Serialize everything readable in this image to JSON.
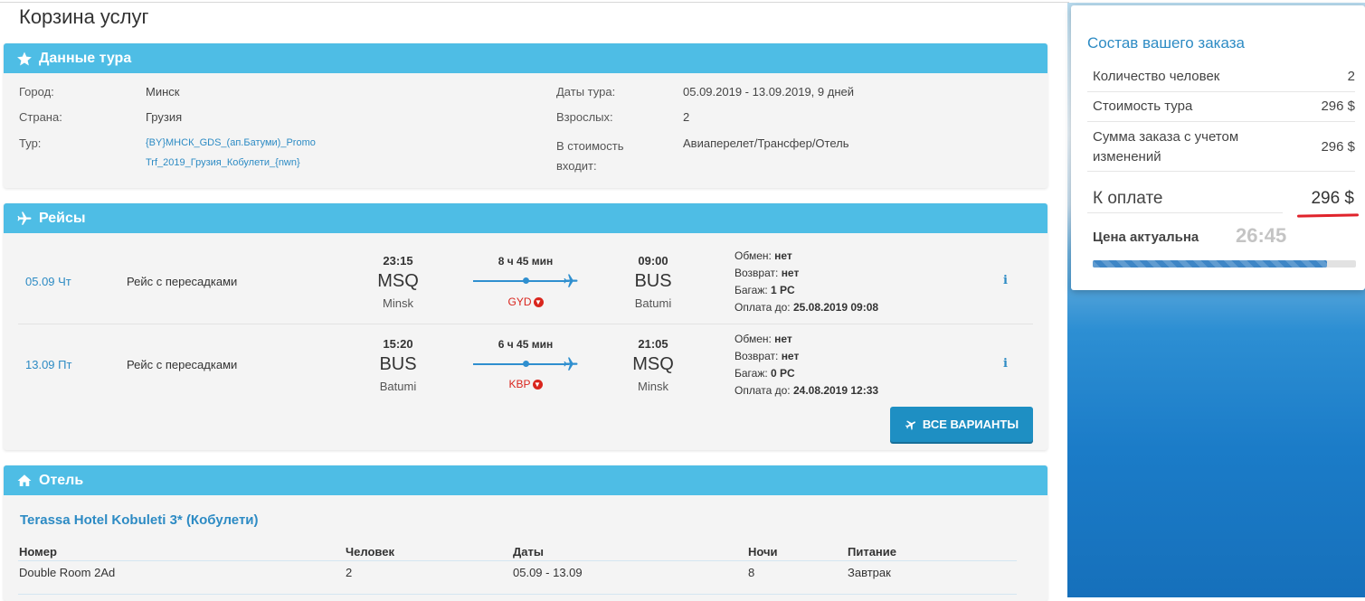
{
  "page_title": "Корзина услуг",
  "tour": {
    "header": "Данные тура",
    "city_label": "Город:",
    "city": "Минск",
    "country_label": "Страна:",
    "country": "Грузия",
    "tour_label": "Тур:",
    "tour_name_line1": "{BY}МНСК_GDS_(ап.Батуми)_Promo",
    "tour_name_line2": "Trf_2019_Грузия_Кобулети_{nwn}",
    "dates_label": "Даты тура:",
    "dates": "05.09.2019 - 13.09.2019, 9 дней",
    "adults_label": "Взрослых:",
    "adults": "2",
    "includes_label_1": "В стоимость",
    "includes_label_2": "входит:",
    "includes": "Авиаперелет/Трансфер/Отель"
  },
  "flights": {
    "header": "Рейсы",
    "items": [
      {
        "date": "05.09 Чт",
        "type": "Рейс с пересадками",
        "dep_time": "23:15",
        "dep_code": "MSQ",
        "dep_city": "Minsk",
        "duration": "8 ч 45 мин",
        "transfer": "GYD",
        "arr_time": "09:00",
        "arr_code": "BUS",
        "arr_city": "Batumi",
        "exchange_label": "Обмен:",
        "exchange": "нет",
        "refund_label": "Возврат:",
        "refund": "нет",
        "baggage_label": "Багаж:",
        "baggage": "1 PC",
        "pay_until_label": "Оплата до:",
        "pay_until": "25.08.2019 09:08"
      },
      {
        "date": "13.09 Пт",
        "type": "Рейс с пересадками",
        "dep_time": "15:20",
        "dep_code": "BUS",
        "dep_city": "Batumi",
        "duration": "6 ч 45 мин",
        "transfer": "KBP",
        "arr_time": "21:05",
        "arr_code": "MSQ",
        "arr_city": "Minsk",
        "exchange_label": "Обмен:",
        "exchange": "нет",
        "refund_label": "Возврат:",
        "refund": "нет",
        "baggage_label": "Багаж:",
        "baggage": "0 PC",
        "pay_until_label": "Оплата до:",
        "pay_until": "24.08.2019 12:33"
      }
    ],
    "info_glyph": "i",
    "all_variants_label": "ВСЕ ВАРИАНТЫ"
  },
  "hotel": {
    "header": "Отель",
    "name": "Terassa Hotel Kobuleti 3* (Кобулети)",
    "columns": [
      "Номер",
      "Человек",
      "Даты",
      "Ночи",
      "Питание"
    ],
    "rows": [
      [
        "Double Room 2Ad",
        "2",
        "05.09 - 13.09",
        "8",
        "Завтрак"
      ]
    ]
  },
  "order": {
    "title": "Состав вашего заказа",
    "people_label": "Количество человек",
    "people": "2",
    "tour_cost_label": "Стоимость тура",
    "tour_cost": "296 $",
    "total_label_1": "Сумма заказа с учетом",
    "total_label_2": "изменений",
    "total": "296 $",
    "pay_label": "К оплате",
    "pay": "296 $",
    "actual_label": "Цена актуальна",
    "timer": "26:45",
    "progress_fraction": 0.89
  },
  "colors": {
    "accent": "#4ebde5",
    "link": "#2d8bc4",
    "button": "#1e8fc3",
    "alert": "#e0232b"
  },
  "icons": [
    "star-icon",
    "plane-icon",
    "home-icon",
    "info-icon",
    "chevron-down-circle-icon"
  ]
}
